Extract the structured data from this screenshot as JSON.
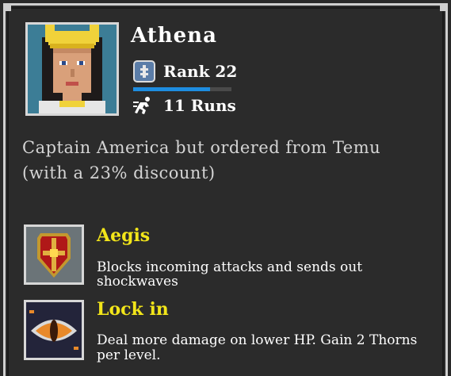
{
  "character": {
    "name": "Athena",
    "rank_label": "Rank 22",
    "xp_progress": 0.78,
    "runs_label": "11 Runs",
    "description": "Captain America but ordered from Temu (with a 23% discount)"
  },
  "abilities": [
    {
      "title": "Aegis",
      "description": "Blocks incoming attacks and sends out shockwaves",
      "icon": "shield-icon"
    },
    {
      "title": "Lock in",
      "description": "Deal more damage on lower HP. Gain 2 Thorns per level.",
      "icon": "eye-icon"
    }
  ],
  "colors": {
    "panel_bg": "#2b2b2b",
    "title_yellow": "#f2e51a",
    "xp_blue": "#1e8de0"
  }
}
